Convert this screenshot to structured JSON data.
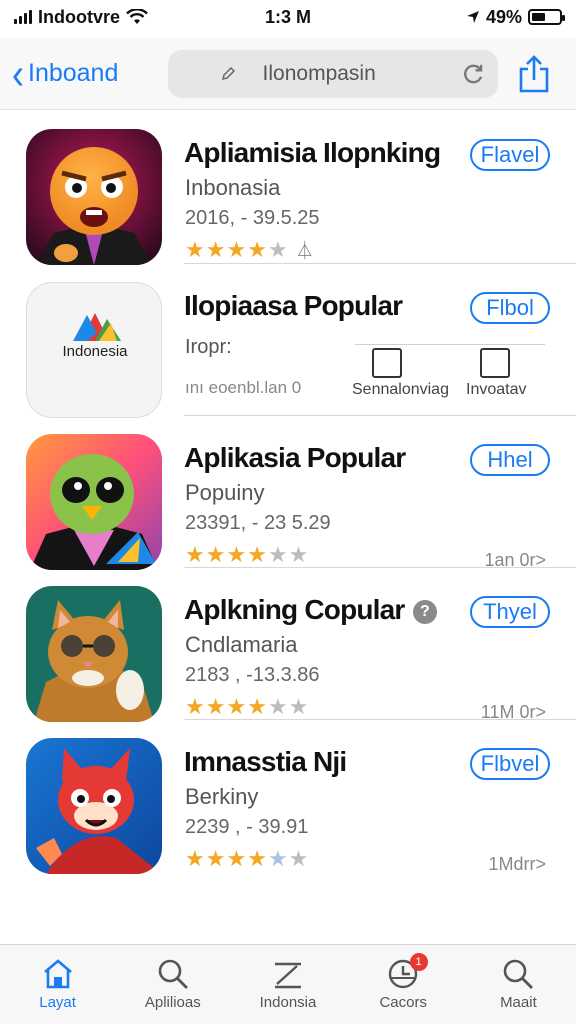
{
  "status_bar": {
    "carrier": "Indootvre",
    "time": "1:3 M",
    "battery_percent": "49%",
    "battery_level": 0.49
  },
  "nav": {
    "back_label": "Inboand",
    "search_placeholder": "Ilonompasin"
  },
  "apps": [
    {
      "title": "Apliamisia Ilopnking",
      "subtitle": "Inbonasia",
      "meta": "2016, - 39.5.25",
      "rating": 3.5,
      "rating_glyph": "⏃",
      "button": "Flavel"
    },
    {
      "title": "Ilopiaasa Popular",
      "subtitle": "Iropr:",
      "meta": "ını eoenbl.lan 0",
      "icon_text": "Indonesia",
      "button": "Flbol",
      "option_1": "Sennalonviag",
      "option_2": "Invoatav"
    },
    {
      "title": "Aplikasia Popular",
      "subtitle": "Popuiny",
      "meta": "23391, - 23 5.29",
      "rating": 4,
      "button": "Hhel",
      "more": "1an 0r>"
    },
    {
      "title": "Aplkning Copular",
      "subtitle": "Cndlamaria",
      "meta": "2183 , -13.3.86",
      "rating": 3.5,
      "button": "Thyel",
      "more": "11M 0r>"
    },
    {
      "title": "Imnasstia Nji",
      "subtitle": "Berkiny",
      "meta": "2239 , - 39.91",
      "rating": 3.5,
      "button": "Flbvel",
      "more": "1Mdrr>"
    }
  ],
  "tabs": [
    {
      "label": "Layat",
      "icon": "home-icon",
      "active": true
    },
    {
      "label": "Aplilioas",
      "icon": "search-icon"
    },
    {
      "label": "Indonsia",
      "icon": "pen-icon"
    },
    {
      "label": "Cacors",
      "icon": "clock-icon",
      "badge": "1"
    },
    {
      "label": "Maait",
      "icon": "search-icon"
    }
  ],
  "colors": {
    "accent": "#1a7cf5",
    "star": "#f5a623",
    "badge": "#e53935"
  }
}
